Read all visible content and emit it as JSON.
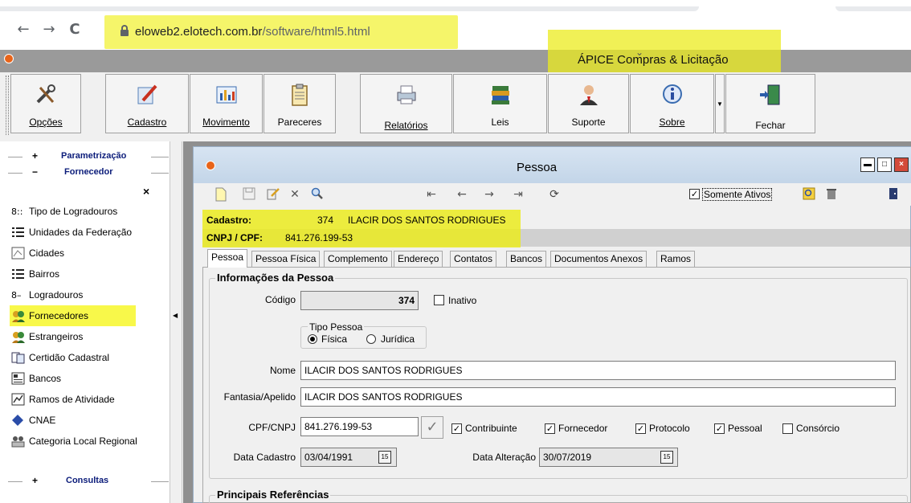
{
  "browser": {
    "back": "←",
    "forward": "→",
    "reload": "C",
    "url_domain": "eloweb2.elotech.com.br",
    "url_path": "/software/html5.html"
  },
  "app": {
    "title": "ÁPICE Compras & Licitação"
  },
  "toolbar": {
    "buttons": [
      {
        "label": "Opções"
      },
      {
        "label": "Cadastro"
      },
      {
        "label": "Movimento"
      },
      {
        "label": "Pareceres"
      },
      {
        "label": "Relatórios"
      },
      {
        "label": "Leis"
      },
      {
        "label": "Suporte"
      },
      {
        "label": "Sobre"
      },
      {
        "label": "Fechar"
      }
    ]
  },
  "sidebar": {
    "sections": {
      "parametrizacao": {
        "sign": "+",
        "title": "Parametrização"
      },
      "fornecedor": {
        "sign": "−",
        "title": "Fornecedor"
      },
      "consultas": {
        "sign": "+",
        "title": "Consultas"
      }
    },
    "close": "×",
    "items": [
      {
        "label": "Tipo de Logradouros"
      },
      {
        "label": "Unidades da Federação"
      },
      {
        "label": "Cidades"
      },
      {
        "label": "Bairros"
      },
      {
        "label": "Logradouros"
      },
      {
        "label": "Fornecedores"
      },
      {
        "label": "Estrangeiros"
      },
      {
        "label": "Certidão Cadastral"
      },
      {
        "label": "Bancos"
      },
      {
        "label": "Ramos de Atividade"
      },
      {
        "label": "CNAE"
      },
      {
        "label": "Categoria Local Regional"
      }
    ]
  },
  "window": {
    "title": "Pessoa",
    "somente_ativos": "Somente Ativos",
    "cadastro_label": "Cadastro:",
    "cadastro_code": "374",
    "cadastro_name": "ILACIR DOS SANTOS RODRIGUES",
    "cnpj_label": "CNPJ / CPF:",
    "cnpj_value": "841.276.199-53"
  },
  "tabs": [
    {
      "label": "Pessoa",
      "active": true
    },
    {
      "label": "Pessoa Física"
    },
    {
      "label": "Complemento"
    },
    {
      "label": "Endereço"
    },
    {
      "label": "Contatos"
    },
    {
      "label": "Bancos"
    },
    {
      "label": "Documentos Anexos"
    },
    {
      "label": "Ramos"
    }
  ],
  "form": {
    "group_title": "Informações da Pessoa",
    "codigo_label": "Código",
    "codigo_value": "374",
    "inativo_label": "Inativo",
    "tipo_pessoa_title": "Tipo Pessoa",
    "fisica_label": "Física",
    "juridica_label": "Jurídica",
    "nome_label": "Nome",
    "nome_value": "ILACIR DOS SANTOS RODRIGUES",
    "fantasia_label": "Fantasia/Apelido",
    "fantasia_value": "ILACIR DOS SANTOS RODRIGUES",
    "cpf_label": "CPF/CNPJ",
    "cpf_value": "841.276.199-53",
    "contribuinte_label": "Contribuinte",
    "fornecedor_label": "Fornecedor",
    "protocolo_label": "Protocolo",
    "pessoal_label": "Pessoal",
    "consorcio_label": "Consórcio",
    "data_cadastro_label": "Data Cadastro",
    "data_cadastro_value": "03/04/1991",
    "data_alteracao_label": "Data Alteração",
    "data_alteracao_value": "30/07/2019",
    "refs_title": "Principais Referências"
  },
  "colors": {
    "highlight": "#f5f56a",
    "accent_orange": "#e8641a",
    "title_blue": "#0b1c7a"
  }
}
